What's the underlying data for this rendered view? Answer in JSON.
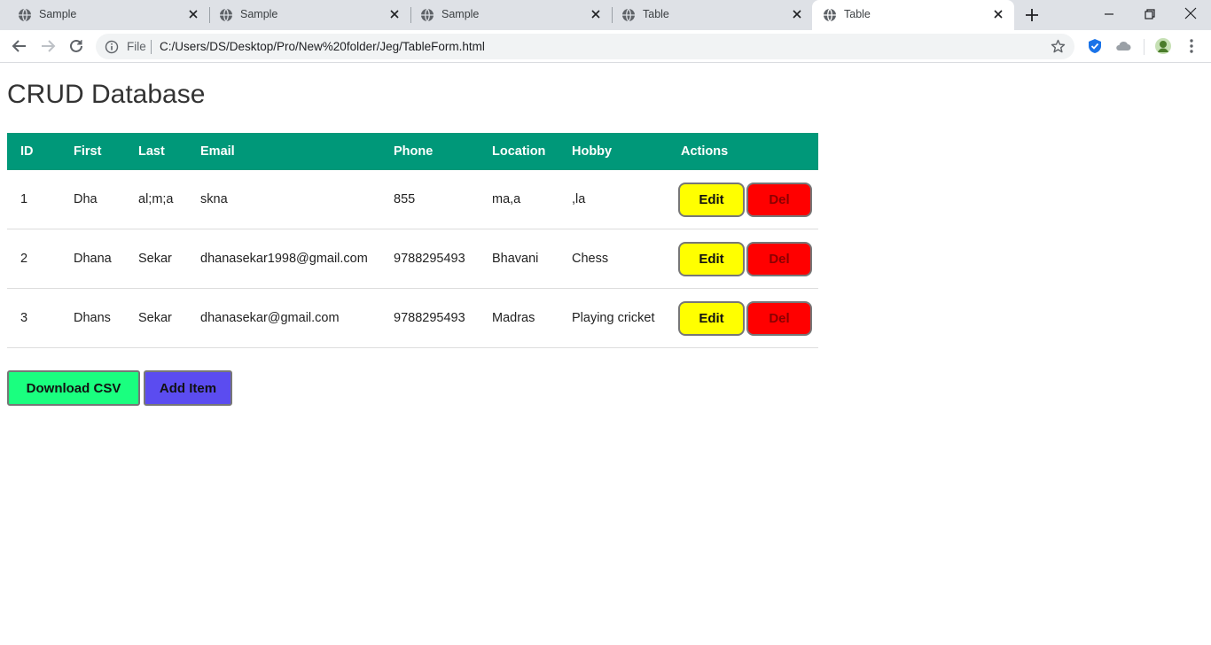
{
  "browser": {
    "tabs": [
      {
        "title": "Sample",
        "active": false
      },
      {
        "title": "Sample",
        "active": false
      },
      {
        "title": "Sample",
        "active": false
      },
      {
        "title": "Table",
        "active": false
      },
      {
        "title": "Table",
        "active": true
      }
    ],
    "address": {
      "scheme_label": "File",
      "url": "C:/Users/DS/Desktop/Pro/New%20folder/Jeg/TableForm.html"
    }
  },
  "page": {
    "title": "CRUD Database",
    "table": {
      "headers": [
        "ID",
        "First",
        "Last",
        "Email",
        "Phone",
        "Location",
        "Hobby",
        "Actions"
      ],
      "rows": [
        {
          "id": "1",
          "first": "Dha",
          "last": "al;m;a",
          "email": "skna",
          "phone": "855",
          "location": "ma,a",
          "hobby": ",la"
        },
        {
          "id": "2",
          "first": "Dhana",
          "last": "Sekar",
          "email": "dhanasekar1998@gmail.com",
          "phone": "9788295493",
          "location": "Bhavani",
          "hobby": "Chess"
        },
        {
          "id": "3",
          "first": "Dhans",
          "last": "Sekar",
          "email": "dhanasekar@gmail.com",
          "phone": "9788295493",
          "location": "Madras",
          "hobby": "Playing cricket"
        }
      ],
      "edit_label": "Edit",
      "delete_label": "Del"
    },
    "download_label": "Download CSV",
    "add_label": "Add Item"
  },
  "colors": {
    "header_bg": "#009879",
    "edit_bg": "#ffff00",
    "delete_bg": "#ff0000",
    "download_bg": "#1aff7f",
    "add_bg": "#5b4cf0"
  }
}
